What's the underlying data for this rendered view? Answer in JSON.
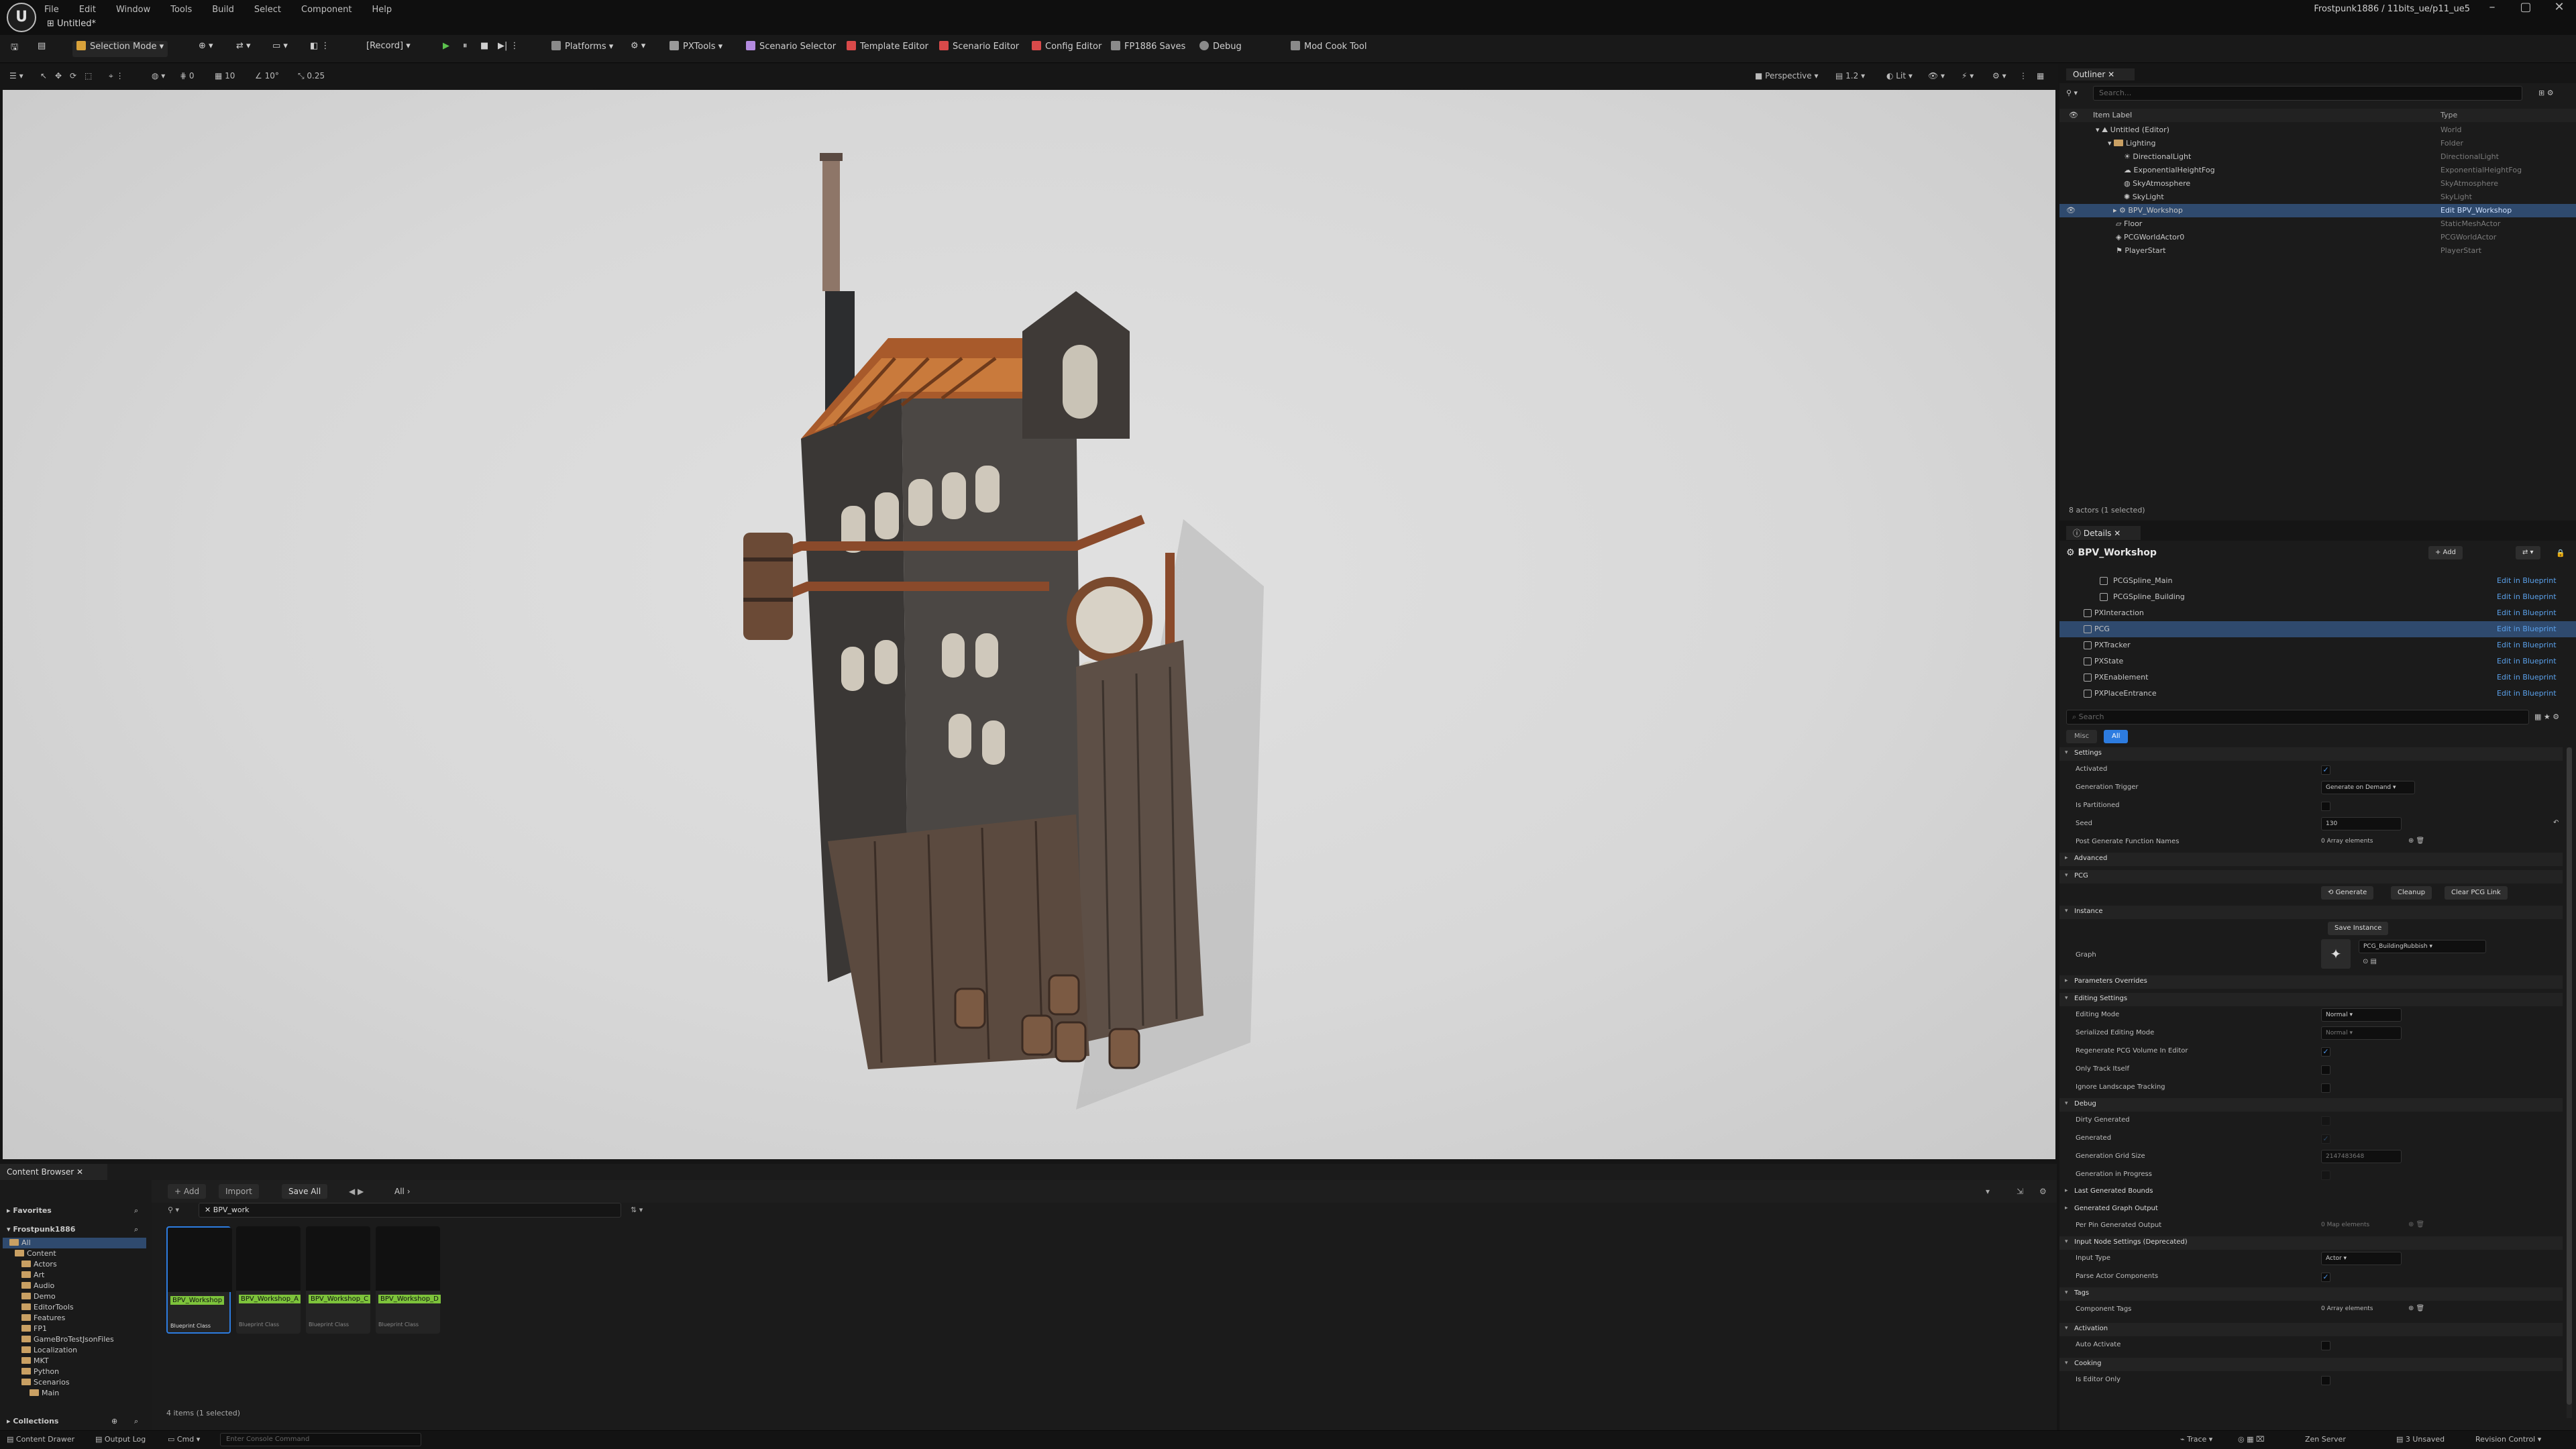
{
  "menu": [
    "File",
    "Edit",
    "Window",
    "Tools",
    "Build",
    "Select",
    "Component",
    "Help"
  ],
  "document_tab": "Untitled*",
  "project_name": "Frostpunk1886 / 11bits_ue/p11_ue5",
  "toolbar": {
    "selection_mode": "Selection Mode",
    "record": "[Record]",
    "platforms": "Platforms",
    "pxtools": "PXTools",
    "scenario_selector": "Scenario Selector",
    "template_editor": "Template Editor",
    "scenario_editor": "Scenario Editor",
    "config_editor": "Config Editor",
    "fp_saves": "FP1886 Saves",
    "debug": "Debug",
    "mod_cook": "Mod Cook Tool"
  },
  "viewport_bar": {
    "grid_snap": "10",
    "rot_snap": "10°",
    "scale_snap": "0.25",
    "cam_speed": "0",
    "perspective": "Perspective",
    "fov": "1.2",
    "lit": "Lit"
  },
  "outliner": {
    "title": "Outliner",
    "search_placeholder": "Search...",
    "col_label": "Item Label",
    "col_type": "Type",
    "rows": [
      {
        "label": "Untitled (Editor)",
        "type": "World"
      },
      {
        "label": "Lighting",
        "type": "Folder"
      },
      {
        "label": "DirectionalLight",
        "type": "DirectionalLight"
      },
      {
        "label": "ExponentialHeightFog",
        "type": "ExponentialHeightFog"
      },
      {
        "label": "SkyAtmosphere",
        "type": "SkyAtmosphere"
      },
      {
        "label": "SkyLight",
        "type": "SkyLight"
      },
      {
        "label": "BPV_Workshop",
        "type": "Edit BPV_Workshop"
      },
      {
        "label": "Floor",
        "type": "StaticMeshActor"
      },
      {
        "label": "PCGWorldActor0",
        "type": "PCGWorldActor"
      },
      {
        "label": "PlayerStart",
        "type": "PlayerStart"
      }
    ],
    "status": "8 actors (1 selected)"
  },
  "details": {
    "title": "Details",
    "object_name": "BPV_Workshop",
    "add_label": "+ Add",
    "edit_in_bp": "Edit in Blueprint",
    "components": [
      "PCGSpline_Main",
      "PCGSpline_Building",
      "PXInteraction",
      "PCG",
      "PXTracker",
      "PXState",
      "PXEnablement",
      "PXPlaceEntrance"
    ],
    "search_placeholder": "Search",
    "filter_misc": "Misc",
    "filter_all": "All",
    "sections": {
      "settings": "Settings",
      "advanced": "Advanced",
      "pcg": "PCG",
      "instance": "Instance",
      "parameters": "Parameters Overrides",
      "editing": "Editing Settings",
      "debug": "Debug",
      "last_bounds": "Last Generated Bounds",
      "graph_output": "Generated Graph Output",
      "input_node": "Input Node Settings (Deprecated)",
      "tags": "Tags",
      "activation": "Activation",
      "cooking": "Cooking"
    },
    "props": {
      "activated": "Activated",
      "gen_trigger": "Generation Trigger",
      "gen_trigger_val": "Generate on Demand",
      "is_partitioned": "Is Partitioned",
      "seed": "Seed",
      "seed_val": "130",
      "post_gen": "Post Generate Function Names",
      "array_elements": "0 Array elements",
      "generate_btn": "Generate",
      "cleanup_btn": "Cleanup",
      "clear_link_btn": "Clear PCG Link",
      "save_instance_btn": "Save Instance",
      "graph": "Graph",
      "graph_val": "PCG_BuildingRubbish",
      "editing_mode": "Editing Mode",
      "editing_mode_val": "Normal",
      "serialized_mode": "Serialized Editing Mode",
      "serialized_mode_val": "Normal",
      "regen_volume": "Regenerate PCG Volume In Editor",
      "only_track": "Only Track Itself",
      "ignore_landscape": "Ignore Landscape Tracking",
      "dirty": "Dirty Generated",
      "generated": "Generated",
      "grid_size": "Generation Grid Size",
      "grid_size_val": "2147483648",
      "in_progress": "Generation in Progress",
      "per_pin": "Per Pin Generated Output",
      "map_elements": "0 Map elements",
      "input_type": "Input Type",
      "input_type_val": "Actor",
      "parse_actor": "Parse Actor Components",
      "component_tags": "Component Tags",
      "auto_activate": "Auto Activate",
      "editor_only": "Is Editor Only"
    }
  },
  "content_browser": {
    "tab": "Content Browser",
    "add": "+ Add",
    "import": "Import",
    "save_all": "Save All",
    "path": "All",
    "favorites": "Favorites",
    "project": "Frostpunk1886",
    "collections": "Collections",
    "search_value": "BPV_work",
    "folders": [
      "All",
      "Content",
      "Actors",
      "Art",
      "Audio",
      "Demo",
      "EditorTools",
      "Features",
      "FP1",
      "GameBroTestJsonFiles",
      "Localization",
      "MKT",
      "Python",
      "Scenarios",
      "Main"
    ],
    "assets": [
      {
        "name": "BPV_Workshop",
        "type": "Blueprint Class"
      },
      {
        "name": "BPV_Workshop_A",
        "type": "Blueprint Class"
      },
      {
        "name": "BPV_Workshop_C",
        "type": "Blueprint Class"
      },
      {
        "name": "BPV_Workshop_D",
        "type": "Blueprint Class"
      }
    ],
    "count": "4 items (1 selected)"
  },
  "statusbar": {
    "content_drawer": "Content Drawer",
    "output_log": "Output Log",
    "cmd": "Cmd",
    "console_placeholder": "Enter Console Command",
    "trace": "Trace",
    "zen": "Zen Server",
    "unsaved": "3 Unsaved",
    "revision": "Revision Control"
  },
  "colors": {
    "accent": "#2f4a6e",
    "link": "#5aa0ea",
    "asset_label": "#7dc33b",
    "folder": "#c9a063"
  }
}
